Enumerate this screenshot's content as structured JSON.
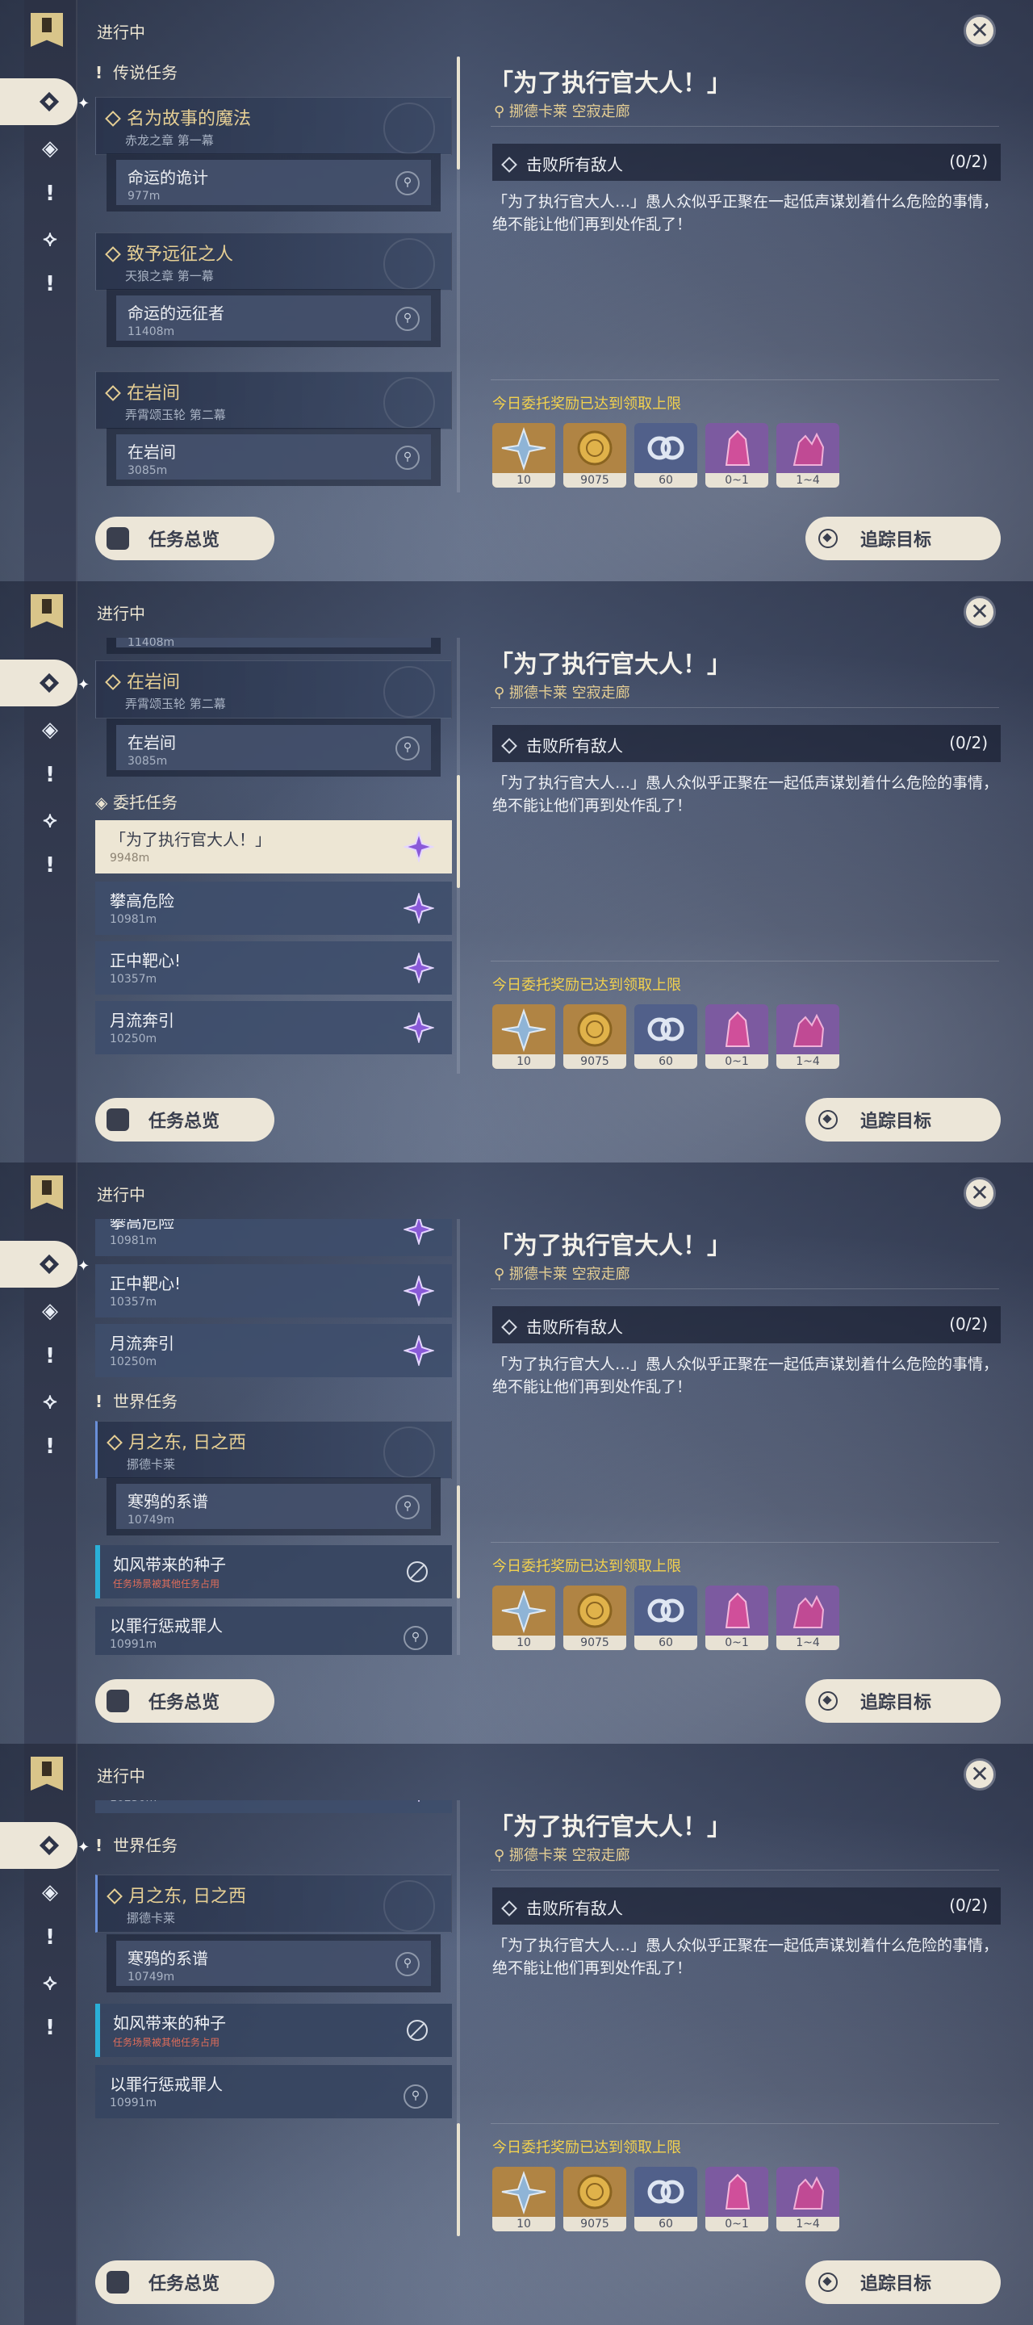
{
  "header": {
    "status": "进行中",
    "close_glyph": "✕"
  },
  "categories": {
    "legend": "传说任务",
    "request": "委托任务",
    "world": "世界任务"
  },
  "quests": {
    "legend1": {
      "title": "名为故事的魔法",
      "subtitle": "赤龙之章 第一幕",
      "step": "命运的诡计",
      "dist": "977m"
    },
    "legend2": {
      "title": "致予远征之人",
      "subtitle": "天狼之章 第一幕",
      "step": "命运的远征者",
      "dist": "11408m"
    },
    "legend3": {
      "title": "在岩间",
      "subtitle": "弄霄颂玉轮 第二幕",
      "step": "在岩间",
      "dist": "3085m"
    },
    "partial_dist": "11408m",
    "req1": {
      "title": "「为了执行官大人！」",
      "dist": "9948m"
    },
    "req2": {
      "title": "攀高危险",
      "dist": "10981m"
    },
    "req3": {
      "title": "正中靶心!",
      "dist": "10357m"
    },
    "req4": {
      "title": "月流奔引",
      "dist": "10250m"
    },
    "world1": {
      "title": "月之东, 日之西",
      "subtitle": "挪德卡莱",
      "step": "寒鸦的系谱",
      "dist": "10749m"
    },
    "world2": {
      "title": "如风带来的种子",
      "note": "任务场景被其他任务占用"
    },
    "world3": {
      "title": "以罪行惩戒罪人",
      "dist": "10991m"
    }
  },
  "buttons": {
    "overview": "任务总览",
    "track": "追踪目标"
  },
  "detail": {
    "title": "「为了执行官大人！」",
    "location": "挪德卡莱 空寂走廊",
    "objective": "击败所有敌人",
    "objective_count": "(0/2)",
    "description": "「为了执行官大人…」愚人众似乎正聚在一起低声谋划着什么危险的事情，绝不能让他们再到处作乱了！",
    "limit_notice": "今日委托奖励已达到领取上限",
    "rewards": [
      {
        "name": "adventure-exp",
        "qty": "10"
      },
      {
        "name": "mora",
        "qty": "9075"
      },
      {
        "name": "friendship-exp",
        "qty": "60"
      },
      {
        "name": "crystal-chunk",
        "qty": "0~1"
      },
      {
        "name": "crystal-ore",
        "qty": "1~4"
      }
    ]
  },
  "colors": {
    "accent": "#e6cf94",
    "notice": "#f3d24e",
    "selected": "#ede6d4",
    "world_marker": "#2ab0d8"
  }
}
